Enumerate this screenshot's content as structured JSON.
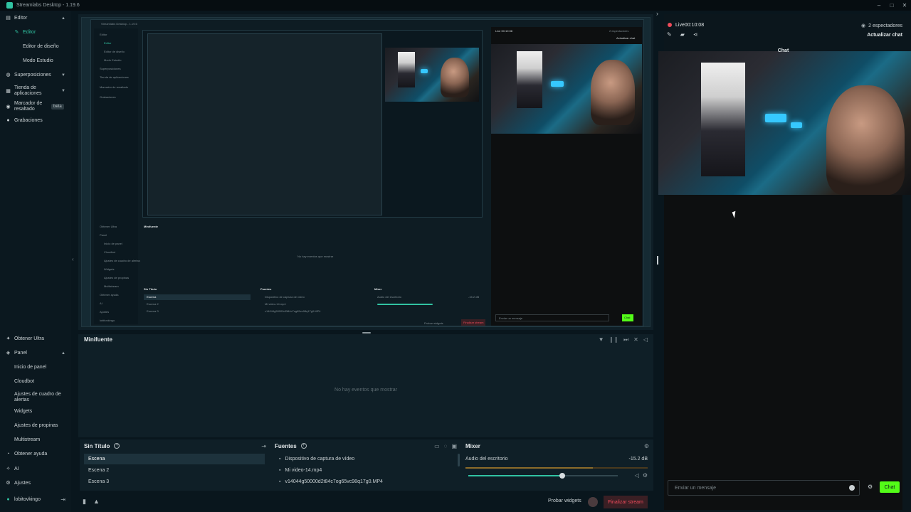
{
  "window": {
    "title": "Streamlabs Desktop - 1.19.6",
    "controls": [
      "–",
      "□",
      "✕"
    ]
  },
  "sidebar": {
    "items": [
      {
        "label": "Editor",
        "icon": "layers-icon",
        "expanded": true
      },
      {
        "label": "Editor",
        "icon": "pencil-icon",
        "active": true
      },
      {
        "label": "Editor de diseño"
      },
      {
        "label": "Modo Estudio"
      },
      {
        "label": "Superposiciones",
        "icon": "paint-icon"
      },
      {
        "label": "Tienda de aplicaciones",
        "icon": "store-icon"
      },
      {
        "label": "Marcador de resaltado",
        "icon": "highlight-icon",
        "badge": "beta"
      },
      {
        "label": "Grabaciones",
        "icon": "record-icon"
      },
      {
        "label": "Obtener Ultra",
        "icon": "ultra-icon"
      },
      {
        "label": "Panel",
        "icon": "dashboard-icon"
      },
      {
        "label": "Inicio de panel"
      },
      {
        "label": "Cloudbot"
      },
      {
        "label": "Ajustes de cuadro de alertas"
      },
      {
        "label": "Widgets"
      },
      {
        "label": "Ajustes de propinas"
      },
      {
        "label": "Multistream"
      },
      {
        "label": "Obtener ayuda",
        "icon": "help-icon"
      },
      {
        "label": "AI",
        "icon": "ai-icon"
      },
      {
        "label": "Ajustes",
        "icon": "gear-icon"
      },
      {
        "label": "lobitovkingo",
        "icon": "avatar-icon"
      }
    ]
  },
  "minifuente": {
    "title": "Minifuente",
    "empty": "No hay eventos que mostrar"
  },
  "scenes": {
    "title": "Sin Título",
    "items": [
      "Escena",
      "Escena 2",
      "Escena 3"
    ],
    "selected": 0
  },
  "sources": {
    "title": "Fuentes",
    "items": [
      "Dispositivo de captura de vídeo",
      "Mi video-14.mp4",
      "v14044g50000d2t84c7og65vc98q17g0.MP4"
    ]
  },
  "mixer": {
    "title": "Mixer",
    "source": "Audio del escritorio",
    "db": "-15.2 dB",
    "volume": 0.63
  },
  "footer": {
    "test_widgets": "Probar widgets",
    "end_stream": "Finalizar stream"
  },
  "nested": {
    "title": "Streamlabs Desktop - 1.19.6",
    "minifuente": "Minifuente",
    "empty": "No hay eventos que mostrar",
    "scenes_title": "Sin Título",
    "sources_title": "Fuentes",
    "mixer_title": "Mixer",
    "mixer_source": "Audio del escritorio",
    "mixer_db": "-15.2 dB",
    "scene_items": [
      "Escena",
      "Escena 2",
      "Escena 3"
    ],
    "source_items": [
      "Dispositivo de captura de vídeo",
      "Mi video-14.mp4",
      "v14044g50000d2t84c7og65vc98q17g0.MP4"
    ],
    "live": "Live 00:10:08",
    "viewers": "2 espectadores",
    "refresh": "Actualizar chat",
    "chat_placeholder": "Enviar un mensaje",
    "chat_send": "Chat",
    "test_widgets": "Probar widgets",
    "end_stream": "Finalizar stream",
    "sidebar": [
      "Editor",
      "Editor",
      "Editor de diseño",
      "Modo Estudio",
      "Superposiciones",
      "Tienda de aplicaciones",
      "Marcador de resaltado",
      "Grabaciones",
      "Obtener Ultra",
      "Panel",
      "Inicio de panel",
      "Cloudbot",
      "Ajustes de cuadro de alertas",
      "Widgets",
      "Ajustes de propinas",
      "Multistream",
      "Obtener ayuda",
      "AI",
      "Ajustes",
      "lobitovkingo"
    ]
  },
  "chat": {
    "live_label": "Live",
    "live_time": "00:10:08",
    "viewers": "2 espectadores",
    "refresh": "Actualizar chat",
    "title": "Chat",
    "placeholder": "Enviar un mensaje",
    "send": "Chat"
  },
  "colors": {
    "accent": "#31c3a2",
    "live": "#ef4b5b",
    "chat_send": "#53fc18",
    "background": "#09161d"
  }
}
